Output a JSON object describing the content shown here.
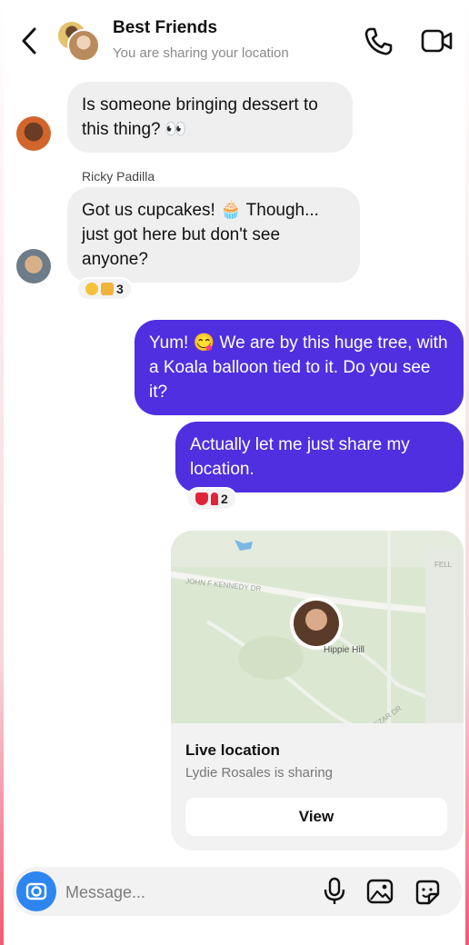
{
  "header": {
    "title": "Best Friends",
    "subtitle": "You are sharing your location"
  },
  "messages": [
    {
      "text": "Is someone bringing dessert to this thing? 👀"
    },
    {
      "sender": "Ricky Padilla",
      "text": "Got us cupcakes! 🧁 Though... just got here but don't see anyone?",
      "reaction_count": "3"
    },
    {
      "text": "Yum! 😋 We are by this huge tree, with a Koala balloon tied to it. Do you see it?"
    },
    {
      "text": "Actually let me just share my location.",
      "reaction_count": "2"
    }
  ],
  "location_card": {
    "map_labels": {
      "road1": "JOHN F KENNEDY DR",
      "place": "Hippie Hill",
      "road2": "KEZAR DR",
      "road3": "FELL"
    },
    "title": "Live location",
    "subtitle": "Lydie Rosales is sharing",
    "button": "View"
  },
  "composer": {
    "placeholder": "Message..."
  },
  "colors": {
    "outgoing_bubble": "#4f2fe0",
    "incoming_bubble": "#efefef",
    "camera_button": "#2d86f0"
  }
}
